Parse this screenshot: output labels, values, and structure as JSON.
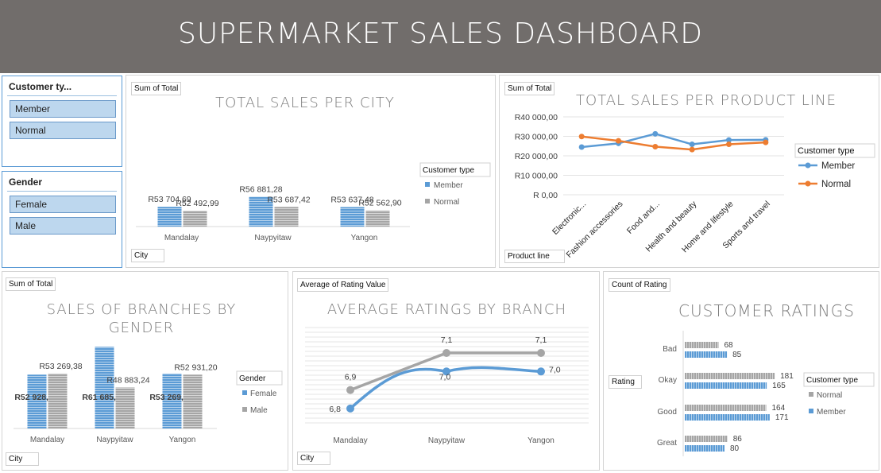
{
  "dashboard_title": "SUPERMARKET SALES DASHBOARD",
  "slicers": {
    "customer_type": {
      "title": "Customer ty...",
      "items": [
        "Member",
        "Normal"
      ]
    },
    "gender": {
      "title": "Gender",
      "items": [
        "Female",
        "Male"
      ]
    }
  },
  "colors": {
    "member": "#5b9bd5",
    "normal": "#a5a5a5",
    "orange": "#ed7d31",
    "header": "#716d6b",
    "slicer_item": "#bdd7ee"
  },
  "chart_data": [
    {
      "id": "city_sales",
      "type": "bar",
      "title": "TOTAL SALES PER CITY",
      "value_field": "Sum of Total",
      "axis_field": "City",
      "legend_title": "Customer type",
      "legend_position": "right",
      "categories": [
        "Mandalay",
        "Naypyitaw",
        "Yangon"
      ],
      "series": [
        {
          "name": "Member",
          "values": [
            53704.69,
            56881.28,
            53637.48
          ],
          "labels": [
            "R53 704,69",
            "R56 881,28",
            "R53 637,48"
          ]
        },
        {
          "name": "Normal",
          "values": [
            52492.99,
            53687.42,
            52562.9
          ],
          "labels": [
            "R52 492,99",
            "R53 687,42",
            "R52 562,90"
          ]
        }
      ]
    },
    {
      "id": "product_line_sales",
      "type": "line",
      "title": "TOTAL SALES PER PRODUCT LINE",
      "value_field": "Sum of Total",
      "axis_field": "Product line",
      "legend_title": "Customer type",
      "legend_position": "right",
      "categories": [
        "Electronic...",
        "Fashion accessories",
        "Food and...",
        "Health and beauty",
        "Home and lifestyle",
        "Sports and travel"
      ],
      "ylim": [
        0,
        40000
      ],
      "yticks": [
        "R 0,00",
        "R10 000,00",
        "R20 000,00",
        "R30 000,00",
        "R40 000,00"
      ],
      "grid": true,
      "series": [
        {
          "name": "Member",
          "values": [
            24500,
            26400,
            31300,
            25900,
            28100,
            28200
          ]
        },
        {
          "name": "Normal",
          "values": [
            29900,
            27700,
            24700,
            23200,
            25900,
            26900
          ]
        }
      ]
    },
    {
      "id": "branch_gender_sales",
      "type": "bar",
      "title": "SALES OF BRANCHES BY GENDER",
      "value_field": "Sum of Total",
      "axis_field": "City",
      "legend_title": "Gender",
      "legend_position": "right",
      "categories": [
        "Mandalay",
        "Naypyitaw",
        "Yangon"
      ],
      "series": [
        {
          "name": "Female",
          "values": [
            52928.3,
            61685.46,
            53269.17
          ],
          "labels": [
            "R52 928,30",
            "R61 685,46",
            "R53 269,17"
          ]
        },
        {
          "name": "Male",
          "values": [
            53269.38,
            48883.24,
            52931.2
          ],
          "labels": [
            "R53 269,38",
            "R48 883,24",
            "R52 931,20"
          ]
        }
      ]
    },
    {
      "id": "avg_rating_branch",
      "type": "line",
      "title": "AVERAGE RATINGS BY BRANCH",
      "value_field": "Average of Rating Value",
      "axis_field": "City",
      "categories": [
        "Mandalay",
        "Naypyitaw",
        "Yangon"
      ],
      "ylim": [
        6.5,
        7.3
      ],
      "grid": true,
      "series": [
        {
          "name": "Member",
          "values": [
            6.8,
            7.0,
            7.0
          ],
          "labels": [
            "6,8",
            "7,0",
            "7,0"
          ]
        },
        {
          "name": "Normal",
          "values": [
            6.9,
            7.1,
            7.1
          ],
          "labels": [
            "6,9",
            "7,1",
            "7,1"
          ]
        }
      ]
    },
    {
      "id": "customer_ratings",
      "type": "bar",
      "orientation": "horizontal",
      "title": "CUSTOMER RATINGS",
      "value_field": "Count of Rating",
      "axis_field": "Rating",
      "legend_title": "Customer type",
      "legend_position": "right",
      "categories": [
        "Bad",
        "Okay",
        "Good",
        "Great"
      ],
      "series": [
        {
          "name": "Normal",
          "values": [
            68,
            181,
            164,
            86
          ]
        },
        {
          "name": "Member",
          "values": [
            85,
            165,
            171,
            80
          ]
        }
      ]
    }
  ]
}
